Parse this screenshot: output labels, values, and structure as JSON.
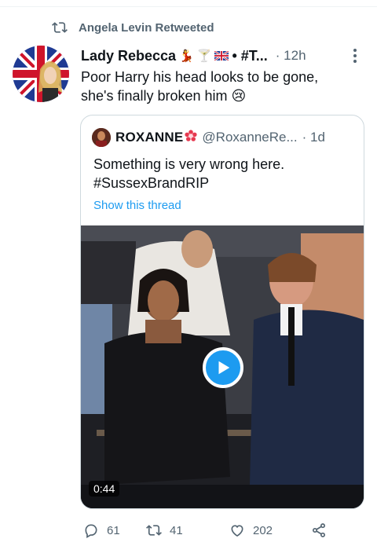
{
  "retweet_banner": {
    "text": "Angela Levin Retweeted",
    "icon": "retweet-icon"
  },
  "tweet": {
    "author_display_name": "Lady Rebecca",
    "author_name_emojis": [
      "💃",
      "🍸",
      "🇬🇧"
    ],
    "author_name_tail": "• #T...",
    "separator": "·",
    "time": "12h",
    "text_line1": "Poor Harry his head looks to be gone,",
    "text_line2": "she's finally broken him",
    "text_emoji": "😢"
  },
  "quoted": {
    "name": "ROXANNE",
    "name_emoji": "🏵",
    "handle": "@RoxanneRe...",
    "separator": "·",
    "time": "1d",
    "text_line1": "Something is very wrong here.",
    "text_line2": "#SussexBrandRIP",
    "show_thread": "Show this thread",
    "video_duration": "0:44"
  },
  "actions": {
    "reply_count": "61",
    "retweet_count": "41",
    "like_count": "202"
  },
  "colors": {
    "accent": "#1d9bf0",
    "secondary_text": "#536471",
    "border": "#cfd9de"
  }
}
